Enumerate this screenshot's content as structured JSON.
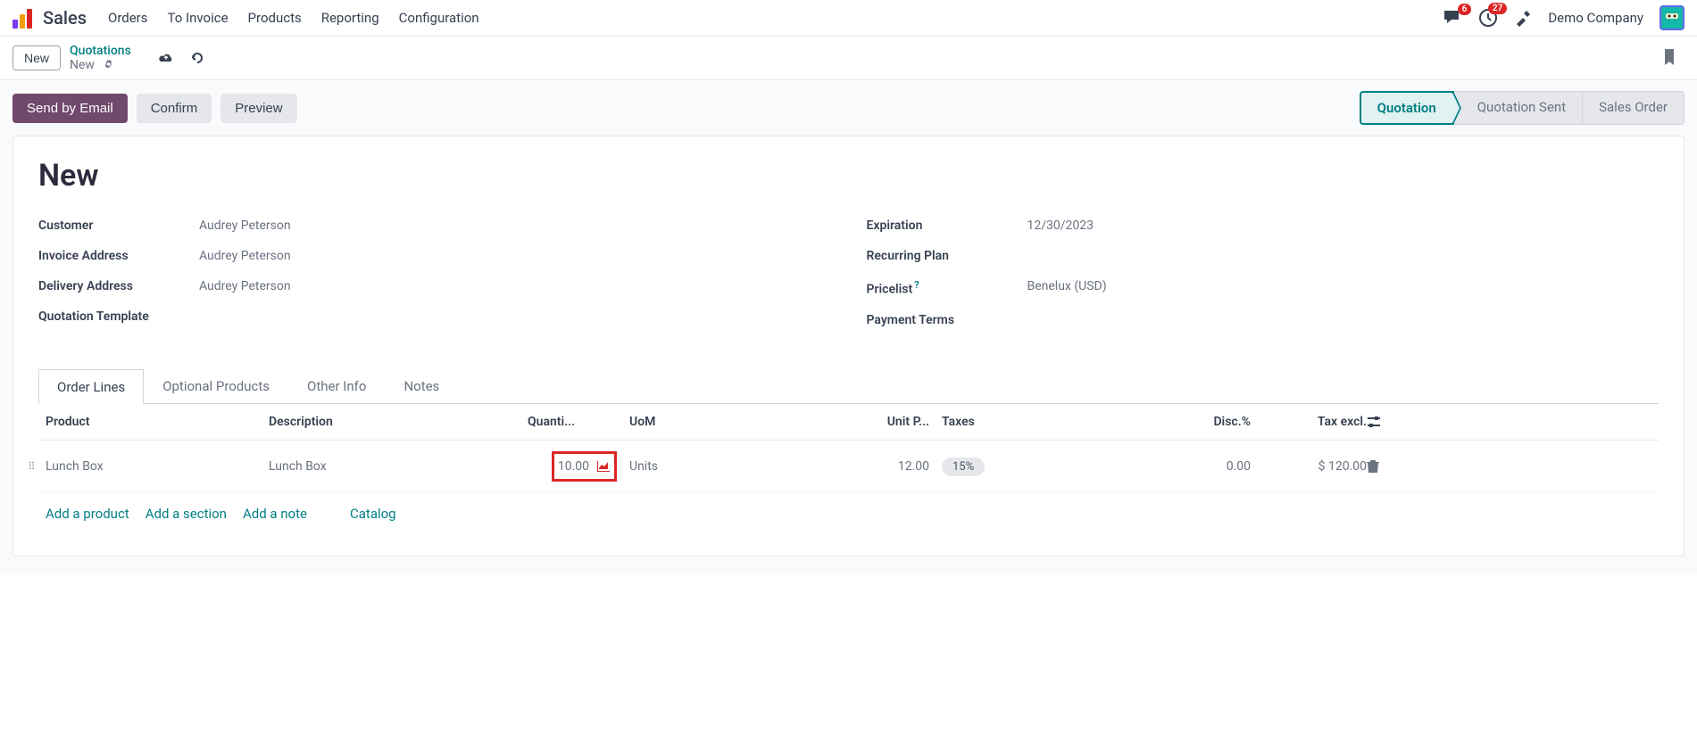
{
  "topbar": {
    "app_title": "Sales",
    "nav": [
      "Orders",
      "To Invoice",
      "Products",
      "Reporting",
      "Configuration"
    ],
    "chat_badge": "6",
    "activity_badge": "27",
    "company": "Demo Company"
  },
  "subbar": {
    "new_btn": "New",
    "breadcrumb_parent": "Quotations",
    "breadcrumb_current": "New"
  },
  "actions": {
    "send_email": "Send by Email",
    "confirm": "Confirm",
    "preview": "Preview"
  },
  "status": {
    "quotation": "Quotation",
    "sent": "Quotation Sent",
    "order": "Sales Order"
  },
  "form": {
    "title": "New",
    "left": {
      "customer_label": "Customer",
      "customer_value": "Audrey Peterson",
      "invoice_label": "Invoice Address",
      "invoice_value": "Audrey Peterson",
      "delivery_label": "Delivery Address",
      "delivery_value": "Audrey Peterson",
      "template_label": "Quotation Template"
    },
    "right": {
      "expiration_label": "Expiration",
      "expiration_value": "12/30/2023",
      "recurring_label": "Recurring Plan",
      "pricelist_label": "Pricelist",
      "pricelist_value": "Benelux (USD)",
      "payment_label": "Payment Terms"
    }
  },
  "tabs": [
    "Order Lines",
    "Optional Products",
    "Other Info",
    "Notes"
  ],
  "table": {
    "headers": {
      "product": "Product",
      "description": "Description",
      "quantity": "Quanti...",
      "uom": "UoM",
      "unit_price": "Unit P...",
      "taxes": "Taxes",
      "disc": "Disc.%",
      "tax_excl": "Tax excl."
    },
    "row": {
      "product": "Lunch Box",
      "description": "Lunch Box",
      "quantity": "10.00",
      "uom": "Units",
      "unit_price": "12.00",
      "taxes": "15%",
      "disc": "0.00",
      "tax_excl": "$ 120.00"
    },
    "add_product": "Add a product",
    "add_section": "Add a section",
    "add_note": "Add a note",
    "catalog": "Catalog"
  }
}
